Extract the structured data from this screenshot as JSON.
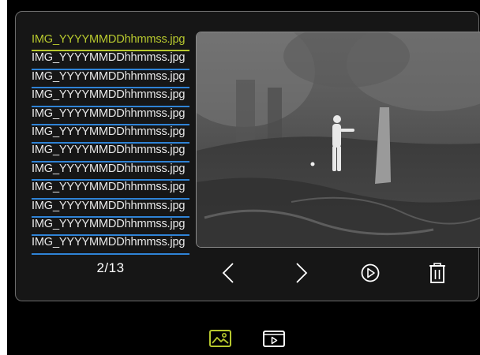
{
  "file_list": [
    "IMG_YYYYMMDDhhmmss.jpg",
    "IMG_YYYYMMDDhhmmss.jpg",
    "IMG_YYYYMMDDhhmmss.jpg",
    "IMG_YYYYMMDDhhmmss.jpg",
    "IMG_YYYYMMDDhhmmss.jpg",
    "IMG_YYYYMMDDhhmmss.jpg",
    "IMG_YYYYMMDDhhmmss.jpg",
    "IMG_YYYYMMDDhhmmss.jpg",
    "IMG_YYYYMMDDhhmmss.jpg",
    "IMG_YYYYMMDDhhmmss.jpg",
    "IMG_YYYYMMDDhhmmss.jpg",
    "IMG_YYYYMMDDhhmmss.jpg"
  ],
  "selected_index": 0,
  "counter": "2/13",
  "controls": {
    "previous_icon": "chevron-left-icon",
    "next_icon": "chevron-right-icon",
    "play_icon": "play-circle-icon",
    "delete_icon": "trash-icon"
  },
  "bottom_tabs": [
    {
      "icon": "image-icon",
      "active": true
    },
    {
      "icon": "video-icon",
      "active": false
    }
  ],
  "colors": {
    "selected": "#b7c82e",
    "list_underline": "#2f83d6",
    "icon": "#ffffff"
  }
}
